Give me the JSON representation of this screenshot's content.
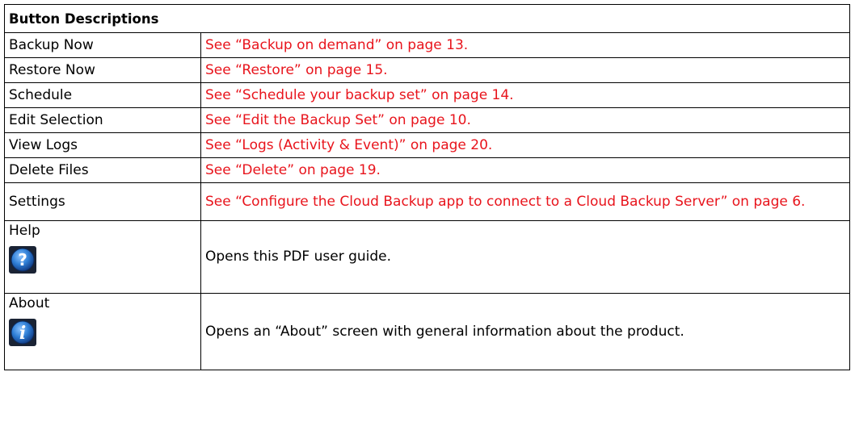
{
  "table": {
    "title": "Button Descriptions",
    "rows": [
      {
        "button": "Backup Now",
        "description": "See “Backup on demand” on page 13.",
        "is_link": true
      },
      {
        "button": "Restore Now",
        "description": "See “Restore” on page 15.",
        "is_link": true
      },
      {
        "button": "Schedule",
        "description": "See “Schedule your backup set” on page 14.",
        "is_link": true
      },
      {
        "button": "Edit Selection",
        "description": "See “Edit the Backup Set” on page 10.",
        "is_link": true
      },
      {
        "button": "View Logs",
        "description": "See “Logs (Activity & Event)” on page 20.",
        "is_link": true
      },
      {
        "button": "Delete Files",
        "description": "See “Delete” on page 19.",
        "is_link": true
      },
      {
        "button": "Settings",
        "description": "See “Configure the Cloud Backup app to connect to a Cloud Backup Server” on page 6.",
        "is_link": true
      },
      {
        "button": "Help",
        "description": "Opens this PDF user guide.",
        "is_link": false,
        "icon": "help-icon"
      },
      {
        "button": "About",
        "description": "Opens an “About” screen with general information about the product.",
        "is_link": false,
        "icon": "info-icon"
      }
    ]
  },
  "colors": {
    "link": "#e8141c",
    "border": "#000000",
    "icon_blue": "#2f7fd6"
  }
}
